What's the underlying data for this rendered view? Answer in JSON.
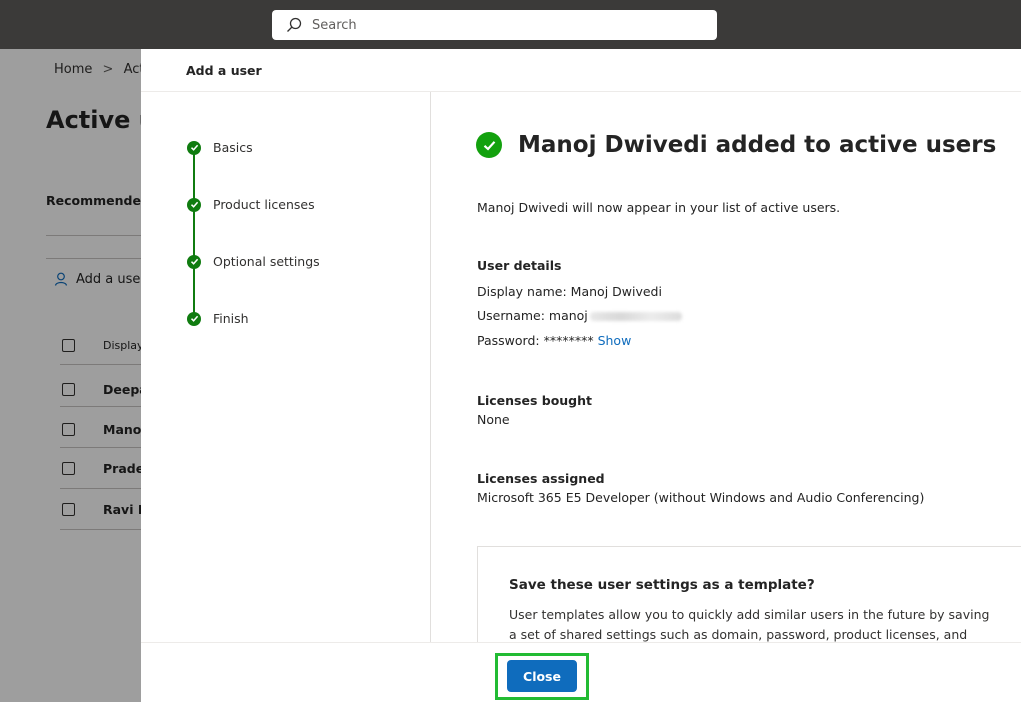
{
  "topbar": {
    "search_placeholder": "Search"
  },
  "background_page": {
    "breadcrumb": {
      "home": "Home",
      "separator": ">",
      "current": "Acti"
    },
    "title": "Active u",
    "recommended": "Recommended",
    "add_user": "Add a user",
    "table": {
      "header": "Display",
      "rows": [
        "Deepa",
        "Manoj",
        "Pradee",
        "Ravi K"
      ]
    }
  },
  "panel": {
    "title": "Add a user",
    "steps": [
      "Basics",
      "Product licenses",
      "Optional settings",
      "Finish"
    ],
    "heading": "Manoj Dwivedi added to active users",
    "intro": "Manoj Dwivedi will now appear in your list of active users.",
    "user_details": {
      "heading": "User details",
      "display_name": "Display name: Manoj Dwivedi",
      "username_prefix": "Username: manoj",
      "password_label": "Password: ********",
      "show_link": "Show"
    },
    "licenses_bought": {
      "heading": "Licenses bought",
      "value": "None"
    },
    "licenses_assigned": {
      "heading": "Licenses assigned",
      "value": "Microsoft 365 E5 Developer (without Windows and Audio Conferencing)"
    },
    "template": {
      "title": "Save these user settings as a template?",
      "description": "User templates allow you to quickly add similar users in the future by saving a set of shared settings such as domain, password, product licenses, and roles."
    },
    "close_label": "Close"
  },
  "colors": {
    "accent": "#0f6cbd",
    "success": "#107c10",
    "highlight": "#22bb33",
    "topbar": "#3b3a39"
  }
}
